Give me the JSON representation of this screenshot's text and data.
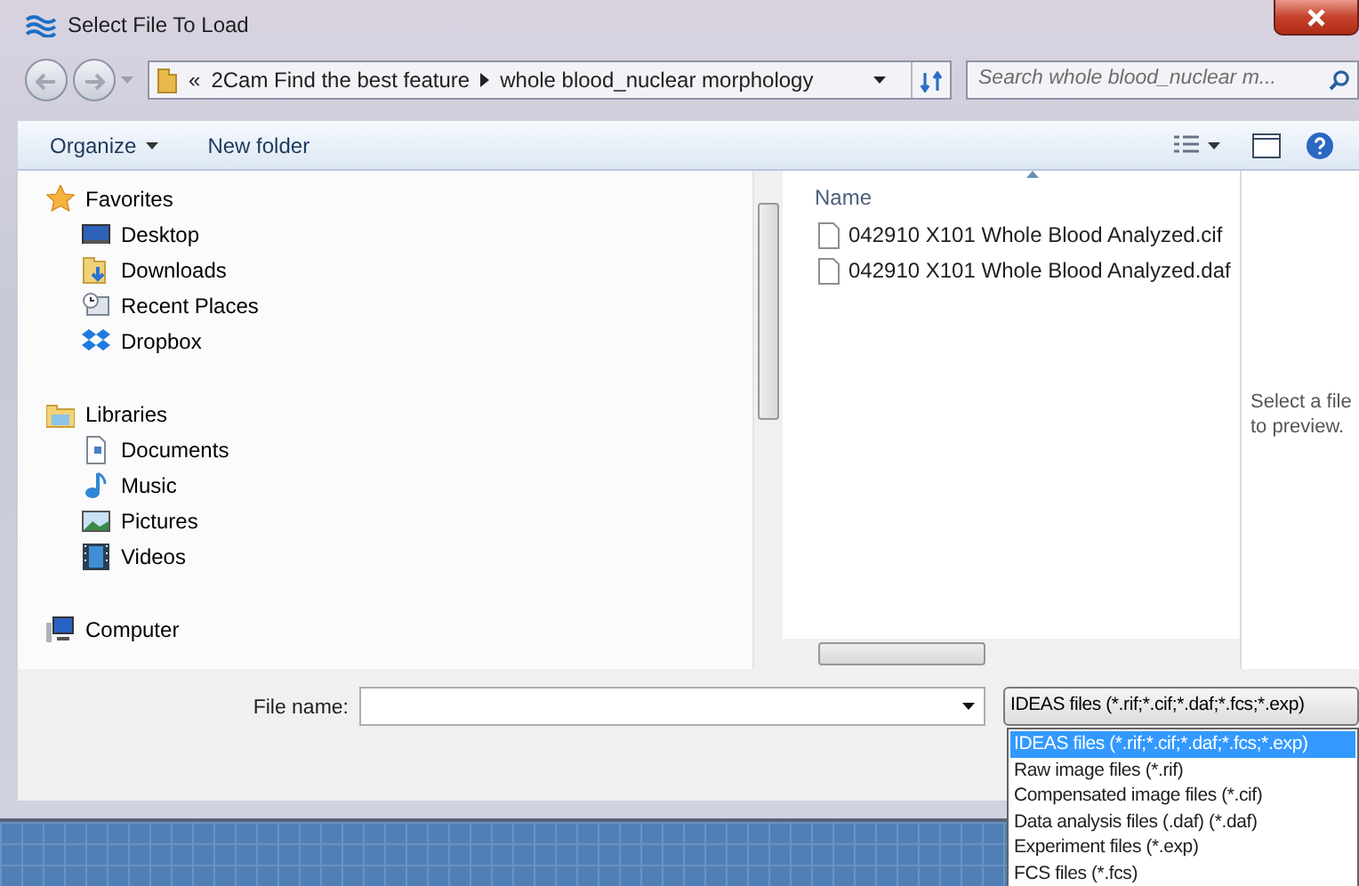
{
  "window": {
    "title": "Select File To Load"
  },
  "address": {
    "prefix": "«",
    "crumbs": [
      "2Cam Find the best feature",
      "whole blood_nuclear morphology"
    ]
  },
  "search": {
    "placeholder": "Search whole blood_nuclear m..."
  },
  "toolbar": [
    {
      "label": "Organize",
      "kind": "menu"
    },
    {
      "label": "New folder",
      "kind": "plain"
    }
  ],
  "navigation": [
    {
      "label": "Favorites",
      "kind": "star",
      "children": [
        {
          "label": "Desktop",
          "kind": "desktop"
        },
        {
          "label": "Downloads",
          "kind": "downloads"
        },
        {
          "label": "Recent Places",
          "kind": "recent"
        },
        {
          "label": "Dropbox",
          "kind": "dropbox"
        }
      ]
    },
    {
      "label": "Libraries",
      "kind": "libraries",
      "children": [
        {
          "label": "Documents",
          "kind": "documents"
        },
        {
          "label": "Music",
          "kind": "music"
        },
        {
          "label": "Pictures",
          "kind": "pictures"
        },
        {
          "label": "Videos",
          "kind": "videos"
        }
      ]
    },
    {
      "label": "Computer",
      "kind": "computer"
    }
  ],
  "file_list": {
    "column": "Name",
    "files": [
      "042910 X101 Whole Blood Analyzed.cif",
      "042910 X101 Whole Blood Analyzed.daf"
    ]
  },
  "preview": {
    "lines": [
      "Select a file",
      "to preview."
    ]
  },
  "file_name": {
    "label": "File name:"
  },
  "filter": {
    "value": "IDEAS files (*.rif;*.cif;*.daf;*.fcs;*.exp)",
    "options": [
      {
        "label": "IDEAS files (*.rif;*.cif;*.daf;*.fcs;*.exp)",
        "selected": true
      },
      {
        "label": "Raw image files (*.rif)",
        "selected": false
      },
      {
        "label": "Compensated image files (*.cif)",
        "selected": false
      },
      {
        "label": "Data analysis files (.daf) (*.daf)",
        "selected": false
      },
      {
        "label": "Experiment files (*.exp)",
        "selected": false
      },
      {
        "label": "FCS files (*.fcs)",
        "selected": false
      }
    ]
  }
}
